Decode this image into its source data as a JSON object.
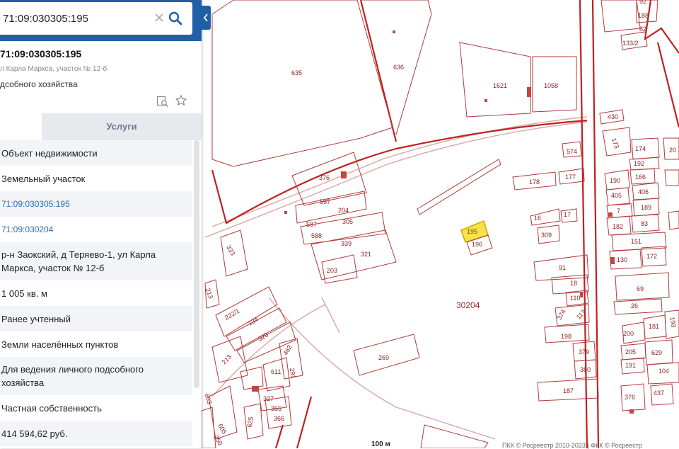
{
  "search": {
    "value": "71:09:030305:195"
  },
  "object": {
    "number": "71:09:030305:195",
    "address_short": "л Карла Маркса, участок № 12-б",
    "use_short": "дсобного хозяйства"
  },
  "tabs": {
    "services": "Услуги"
  },
  "rows": [
    {
      "value": "Объект недвижимости"
    },
    {
      "value": "Земельный участок"
    },
    {
      "value": "71:09:030305:195",
      "link": true
    },
    {
      "value": "71:09:030204",
      "link": true
    },
    {
      "value": "р-н Заокский, д Теряево-1, ул Карла Маркса, участок № 12-б"
    },
    {
      "value": "1 005 кв. м"
    },
    {
      "value": "Ранее учтенный"
    },
    {
      "value": "Земли населённых пунктов"
    },
    {
      "value": "Для ведения личного подсобного хозяйства"
    },
    {
      "value": "Частная собственность"
    },
    {
      "value": "414 594,62 руб."
    }
  ],
  "map": {
    "quarter_label": "30204",
    "scale_label": "100 м",
    "copyright": "ПКК © Росреестр 2010-2023 | ФКК © Росреестр",
    "parcel_labels": [
      "635",
      "636",
      "1621",
      "1058",
      "92",
      "188",
      "82",
      "133/2",
      "430",
      "173",
      "174",
      "20",
      "192",
      "574",
      "177",
      "178",
      "190",
      "166",
      "405",
      "406",
      "376",
      "597",
      "204",
      "587",
      "305",
      "588",
      "339",
      "321",
      "203",
      "195",
      "196",
      "16",
      "17",
      "309",
      "7",
      "189",
      "182",
      "83",
      "151",
      "130",
      "172",
      "333",
      "91",
      "18",
      "110",
      "69",
      "26",
      "213",
      "222/1",
      "134",
      "320",
      "374",
      "117",
      "198",
      "200",
      "181",
      "193",
      "213",
      "462",
      "611",
      "291",
      "269",
      "379",
      "380",
      "205",
      "629",
      "191",
      "104",
      "187",
      "376",
      "437",
      "327",
      "365",
      "625",
      "366",
      "605",
      "603",
      "250"
    ],
    "colors": {
      "boundary": "#c21f1f",
      "parcel": "#b23a3a",
      "road": "#d9a7a7",
      "highlight": "#f7e24a"
    }
  }
}
